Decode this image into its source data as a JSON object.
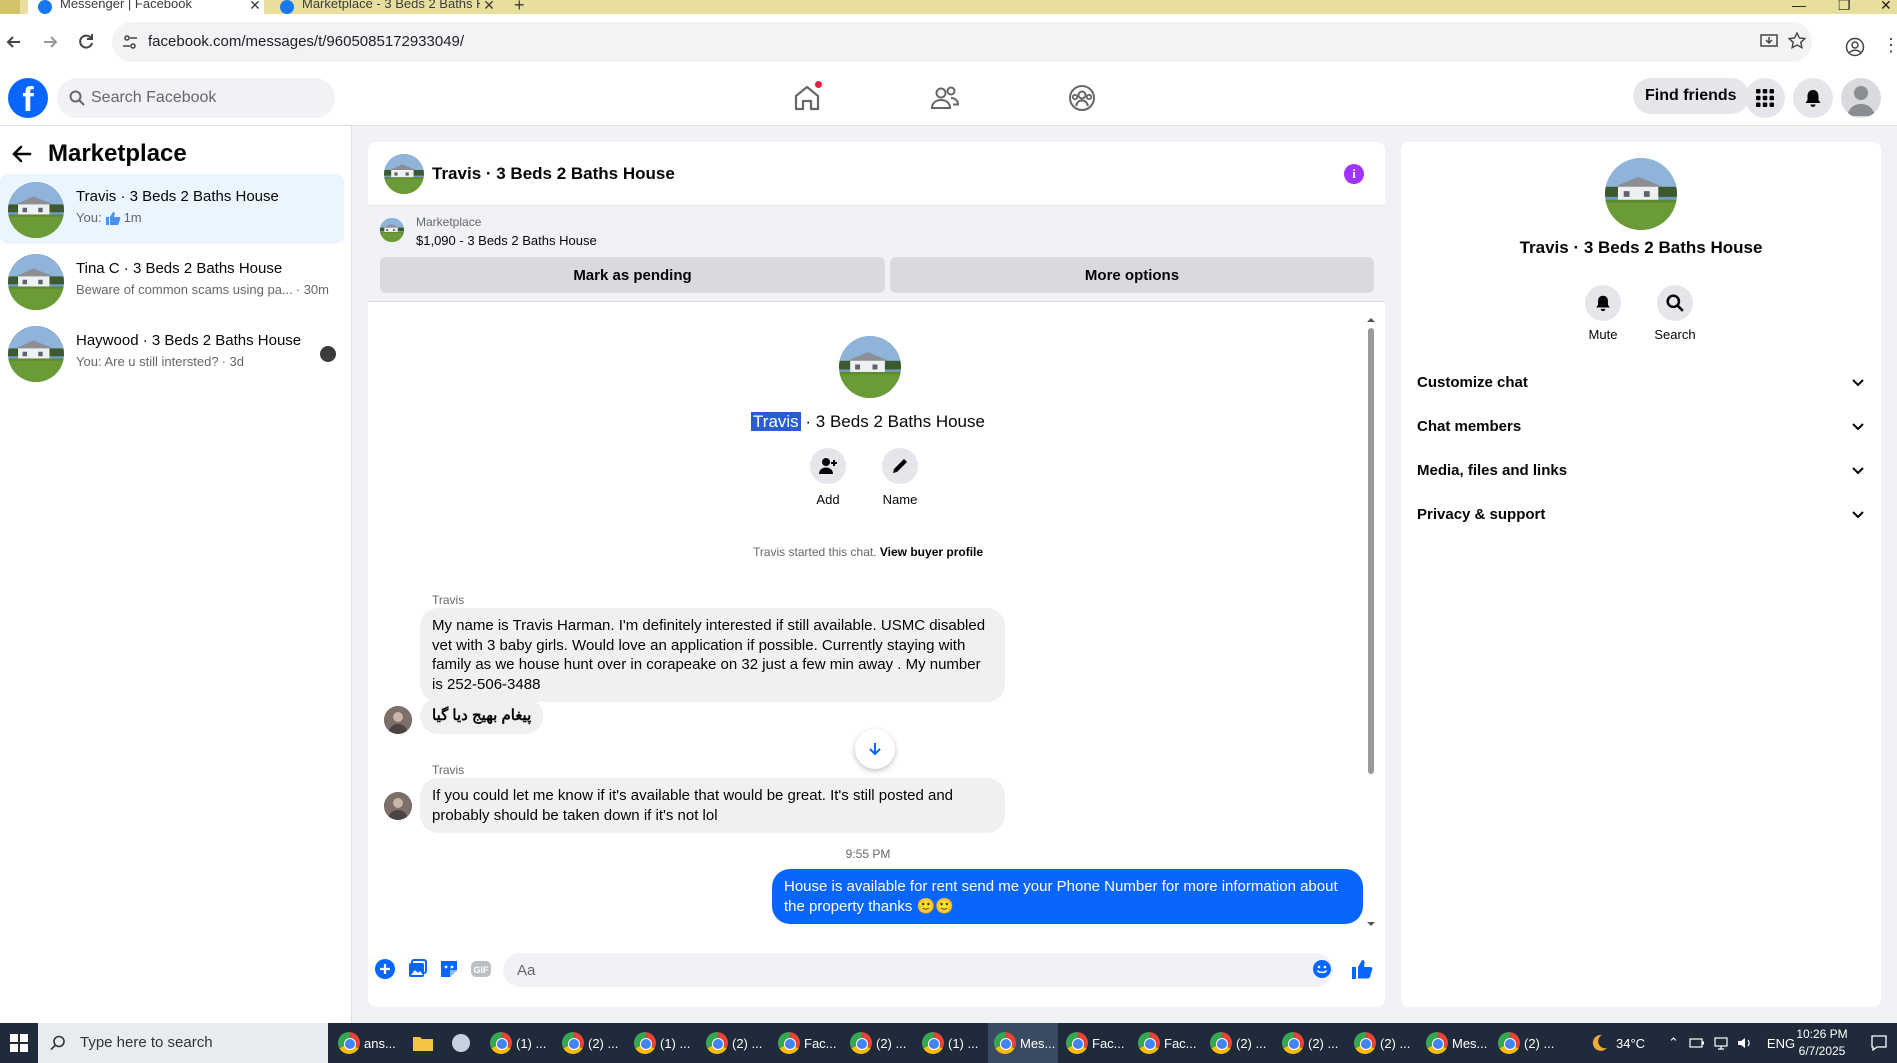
{
  "browser": {
    "tabs": [
      {
        "title": "Messenger | Facebook",
        "active": true
      },
      {
        "title": "Marketplace - 3 Beds 2 Baths H",
        "active": false
      }
    ],
    "new_tab": "+",
    "url": "facebook.com/messages/t/9605085172933049/"
  },
  "fb_header": {
    "logo": "f",
    "search_placeholder": "Search Facebook",
    "find_friends": "Find friends"
  },
  "sidebar": {
    "title": "Marketplace",
    "conversations": [
      {
        "name": "Travis · 3 Beds 2 Baths House",
        "preview": "You:",
        "time": "1m",
        "active": true
      },
      {
        "name": "Tina C · 3 Beds 2 Baths House",
        "preview": "Beware of common scams using pa...",
        "time": "· 30m",
        "active": false
      },
      {
        "name": "Haywood · 3 Beds 2 Baths House",
        "preview": "You: Are u still intersted?",
        "time": "· 3d",
        "active": false
      }
    ]
  },
  "chat": {
    "title": "Travis · 3 Beds 2 Baths House",
    "info_icon": "i",
    "listing": {
      "label": "Marketplace",
      "price_title": "$1,090 - 3 Beds 2 Baths House",
      "mark_pending": "Mark as pending",
      "more_options": "More options"
    },
    "profile": {
      "name_highlight": "Travis",
      "name_rest": " · 3 Beds 2 Baths House",
      "add_label": "Add",
      "name_label": "Name"
    },
    "started_text": "Travis started this chat.",
    "view_buyer_profile": "View buyer profile",
    "messages": [
      {
        "sender": "Travis",
        "text": "My name is Travis Harman. I'm definitely interested if still available. USMC disabled vet with 3 baby girls. Would love an application if possible. Currently staying with family as we house hunt over in corapeake on 32 just a few min away . My number is 252-506-3488"
      },
      {
        "text": "پیغام بھیج دیا گیا"
      },
      {
        "sender": "Travis",
        "text": "If you could let me know if it's available that would be great. It's still posted and probably should be taken down if it's not lol"
      },
      {
        "timestamp": "9:55 PM"
      },
      {
        "outgoing": true,
        "text": "House is available for rent send me your Phone Number for more information about the property thanks 🙂🙂"
      }
    ],
    "composer_placeholder": "Aa"
  },
  "right_panel": {
    "name": "Travis · 3 Beds 2 Baths House",
    "mute": "Mute",
    "search": "Search",
    "sections": [
      "Customize chat",
      "Chat members",
      "Media, files and links",
      "Privacy & support"
    ]
  },
  "taskbar": {
    "search_placeholder": "Type here to search",
    "items": [
      "ans...",
      "(1) ...",
      "(2) ...",
      "(1) ...",
      "(2) ...",
      "Fac...",
      "(2) ...",
      "(1) ...",
      "Mes...",
      "Fac...",
      "Fac...",
      "(2) ...",
      "(2) ...",
      "(2) ...",
      "Mes...",
      "(2) ..."
    ],
    "weather": "34°C",
    "language": "ENG",
    "time": "10:26 PM",
    "date": "6/7/2025"
  },
  "colors": {
    "fb_blue": "#0866ff",
    "info_purple": "#a033ff",
    "active_conversation": "#ebf5ff",
    "taskbar": "#1f2a3a"
  },
  "icons": [
    "home-icon",
    "friends-icon",
    "groups-icon",
    "apps-grid-icon",
    "bell-icon",
    "like-icon",
    "plus-icon",
    "photo-icon",
    "sticker-icon",
    "gif-icon",
    "emoji-icon"
  ]
}
